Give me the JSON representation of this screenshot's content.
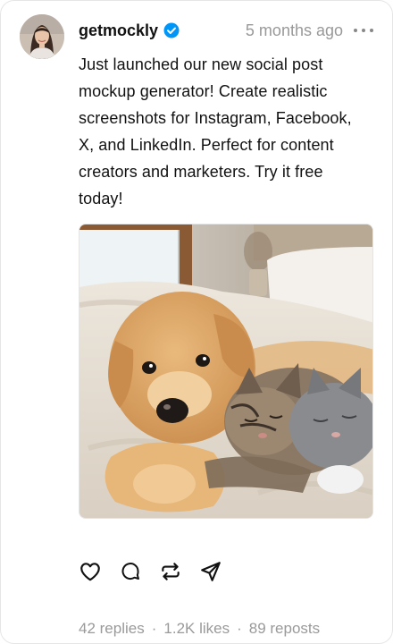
{
  "post": {
    "username": "getmockly",
    "verified": true,
    "timestamp": "5 months ago",
    "text": "Just launched our new social post mockup generator! Create realistic screenshots for Instagram, Facebook, X, and LinkedIn. Perfect for content creators and marketers. Try it free today!",
    "image_icon": "puppy-and-kitten-photo"
  },
  "actions": {
    "like_icon": "heart-icon",
    "reply_icon": "comment-icon",
    "repost_icon": "repost-icon",
    "share_icon": "send-icon"
  },
  "stats": {
    "replies": "42 replies",
    "likes": "1.2K likes",
    "reposts": "89 reposts",
    "separator": "·"
  },
  "colors": {
    "verified_badge": "#0095f6",
    "muted_text": "#999999"
  }
}
